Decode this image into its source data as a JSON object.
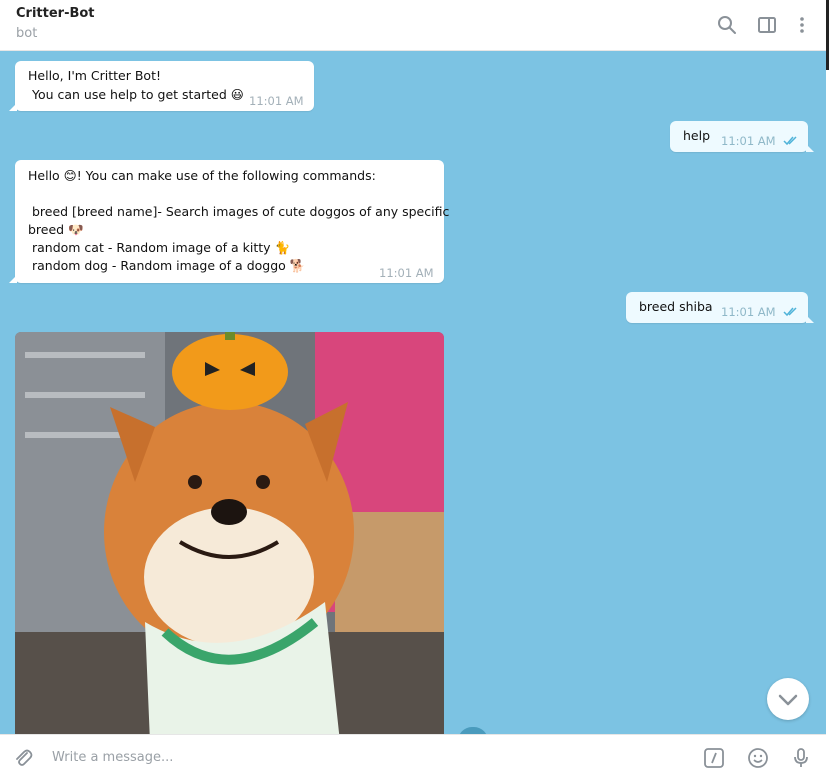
{
  "header": {
    "title": "Critter-Bot",
    "subtitle": "bot"
  },
  "messages": {
    "m1": {
      "line1": "Hello, I'm Critter Bot!",
      "line2": " You can use help to get started 😃",
      "time": "11:01 AM"
    },
    "m2": {
      "text": "help",
      "time": "11:01 AM"
    },
    "m3": {
      "line1": "Hello 😊! You can make use of the following commands:",
      "line2": " breed [breed name]- Search images of cute doggos of any specific",
      "line3": "breed 🐶",
      "line4": " random cat - Random image of a kitty 🐈",
      "line5": " random dog - Random image of a doggo 🐕",
      "time": "11:01 AM"
    },
    "m4": {
      "text": "breed shiba",
      "time": "11:01 AM"
    }
  },
  "composer": {
    "placeholder": "Write a message..."
  },
  "icons": {
    "header": [
      "search-icon",
      "sidebar-toggle-icon",
      "more-vertical-icon"
    ],
    "composer": [
      "attach-icon",
      "bot-commands-icon",
      "emoji-icon",
      "microphone-icon"
    ],
    "scroll": "chevron-down-icon"
  },
  "colors": {
    "chat_bg": "#7cc3e3",
    "outgoing_bubble": "#eefaff",
    "read_ticks": "#4fb3d9"
  }
}
